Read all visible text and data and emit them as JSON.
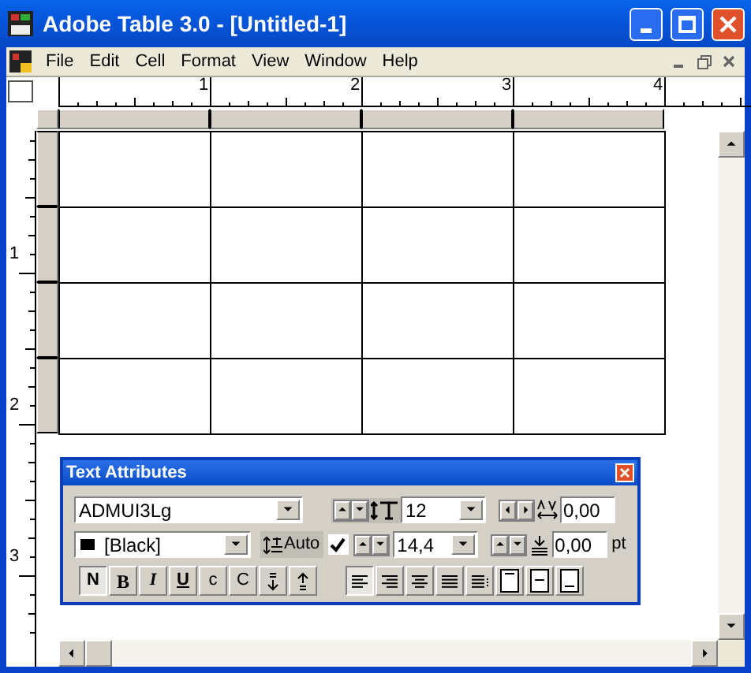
{
  "window": {
    "title": "Adobe Table 3.0 - [Untitled-1]"
  },
  "menu": [
    "File",
    "Edit",
    "Cell",
    "Format",
    "View",
    "Window",
    "Help"
  ],
  "top_ruler": {
    "marks": [
      "1",
      "2",
      "3",
      "4"
    ]
  },
  "left_ruler": {
    "marks": [
      "1",
      "2",
      "3"
    ]
  },
  "palette": {
    "title": "Text Attributes",
    "font": "ADMUI3Lg",
    "size": "12",
    "tracking": "0,00",
    "swatch_name": "[Black]",
    "leading_label": "Auto",
    "auto_leading": true,
    "leading": "14,4",
    "baseline_shift": "0,00",
    "unit": "pt",
    "styles": [
      {
        "kind": "text",
        "label": "N",
        "selected": true
      },
      {
        "kind": "text",
        "label": "B",
        "selected": false
      },
      {
        "kind": "text",
        "label": "I",
        "selected": false
      },
      {
        "kind": "text",
        "label": "U",
        "selected": false
      },
      {
        "kind": "text",
        "label": "c",
        "selected": false
      },
      {
        "kind": "text",
        "label": "C",
        "selected": false
      },
      {
        "kind": "superscript",
        "selected": false
      },
      {
        "kind": "subscript",
        "selected": false
      }
    ],
    "alignments": [
      {
        "kind": "left",
        "selected": true
      },
      {
        "kind": "right",
        "selected": false
      },
      {
        "kind": "center",
        "selected": false
      },
      {
        "kind": "justify",
        "selected": false
      },
      {
        "kind": "justify-last",
        "selected": false
      },
      {
        "kind": "top",
        "selected": false
      },
      {
        "kind": "middle",
        "selected": false
      },
      {
        "kind": "bottom",
        "selected": false
      }
    ]
  }
}
